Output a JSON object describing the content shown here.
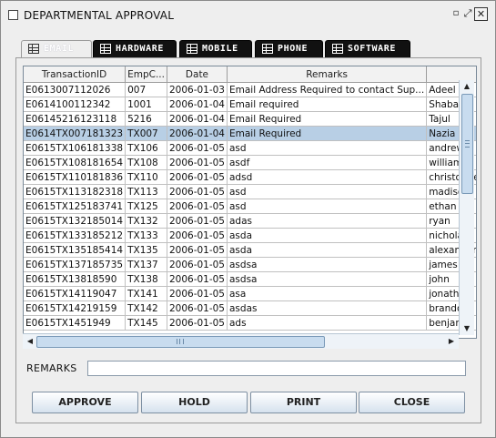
{
  "window": {
    "title": "DEPARTMENTAL APPROVAL",
    "minimize_glyph": "▫",
    "maximize_glyph": "⤢",
    "close_glyph": "✕"
  },
  "tabs": [
    {
      "label": "EMAIL",
      "active": true,
      "icon": "table-icon"
    },
    {
      "label": "HARDWARE",
      "active": false,
      "icon": "table-icon"
    },
    {
      "label": "MOBILE",
      "active": false,
      "icon": "table-icon"
    },
    {
      "label": "PHONE",
      "active": false,
      "icon": "table-icon"
    },
    {
      "label": "SOFTWARE",
      "active": false,
      "icon": "table-icon"
    }
  ],
  "table": {
    "columns": [
      "TransactionID",
      "EmpC...",
      "Date",
      "Remarks",
      ""
    ],
    "selected_row": 3,
    "rows": [
      [
        "E0613007112026",
        "007",
        "2006-01-03",
        "Email Address Required to contact Sup...",
        "Adeel"
      ],
      [
        "E0614100112342",
        "1001",
        "2006-01-04",
        "Email required",
        "Shabana"
      ],
      [
        "E06145216123118",
        "5216",
        "2006-01-04",
        "Email Required",
        "Tajul"
      ],
      [
        "E0614TX007181323",
        "TX007",
        "2006-01-04",
        "Email Required",
        "Nazia"
      ],
      [
        "E0615TX106181338",
        "TX106",
        "2006-01-05",
        "asd",
        "andrew"
      ],
      [
        "E0615TX108181654",
        "TX108",
        "2006-01-05",
        "asdf",
        "william"
      ],
      [
        "E0615TX110181836",
        "TX110",
        "2006-01-05",
        "adsd",
        "christopher"
      ],
      [
        "E0615TX113182318",
        "TX113",
        "2006-01-05",
        "asd",
        "madison"
      ],
      [
        "E0615TX125183741",
        "TX125",
        "2006-01-05",
        "asd",
        "ethan"
      ],
      [
        "E0615TX132185014",
        "TX132",
        "2006-01-05",
        "adas",
        "ryan"
      ],
      [
        "E0615TX133185212",
        "TX133",
        "2006-01-05",
        "asda",
        "nicholas"
      ],
      [
        "E0615TX135185414",
        "TX135",
        "2006-01-05",
        "asda",
        "alexander"
      ],
      [
        "E0615TX137185735",
        "TX137",
        "2006-01-05",
        "asdsa",
        "james"
      ],
      [
        "E0615TX13818590",
        "TX138",
        "2006-01-05",
        "asdsa",
        "john"
      ],
      [
        "E0615TX14119047",
        "TX141",
        "2006-01-05",
        "asa",
        "jonathan"
      ],
      [
        "E0615TX14219159",
        "TX142",
        "2006-01-05",
        "asdas",
        "brandon"
      ],
      [
        "E0615TX1451949",
        "TX145",
        "2006-01-05",
        "ads",
        "benjamin"
      ]
    ]
  },
  "scrollbars": {
    "up": "▲",
    "down": "▼",
    "left": "◀",
    "right": "▶"
  },
  "form": {
    "remarks_label": "REMARKS",
    "remarks_value": ""
  },
  "buttons": {
    "approve": "APPROVE",
    "hold": "HOLD",
    "print": "PRINT",
    "close": "CLOSE"
  }
}
